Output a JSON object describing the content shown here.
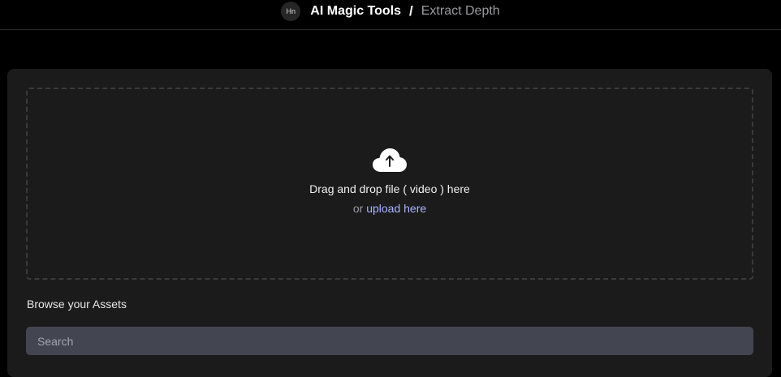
{
  "header": {
    "avatar_initials": "Hn",
    "app_title": "AI Magic Tools",
    "separator": "/",
    "page_title": "Extract Depth"
  },
  "dropzone": {
    "icon": "cloud-upload-icon",
    "instruction": "Drag and drop file ( video ) here",
    "or_text": "or",
    "upload_link": "upload here"
  },
  "assets": {
    "browse_label": "Browse your Assets",
    "search_placeholder": "Search"
  },
  "colors": {
    "background": "#000000",
    "panel": "#1b1b1b",
    "link": "#a9b4ff",
    "search_bg": "#434650"
  }
}
